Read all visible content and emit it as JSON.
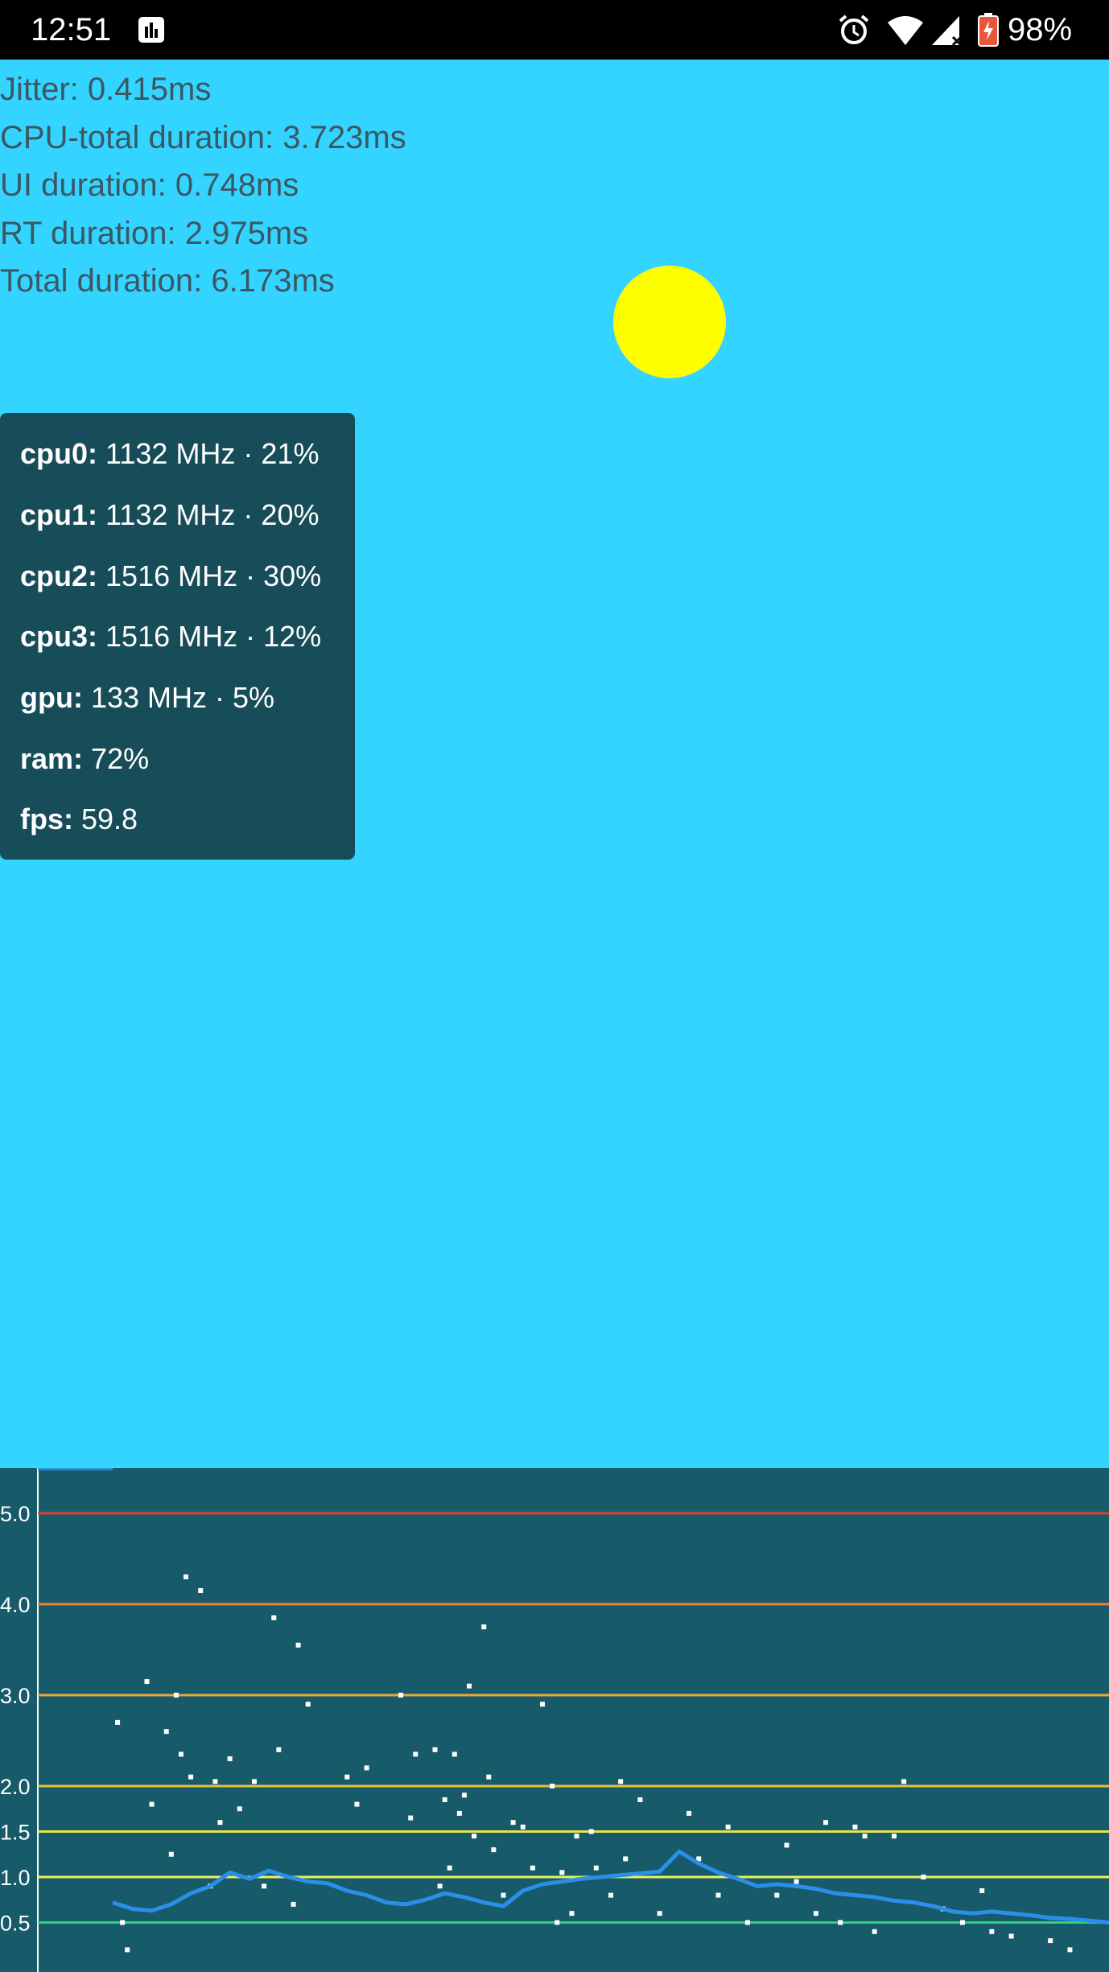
{
  "status_bar": {
    "time": "12:51",
    "battery_percent": "98%",
    "icons": [
      "app-notification-icon",
      "alarm-icon",
      "wifi-icon",
      "cell-signal-icon",
      "battery-charging-icon"
    ],
    "battery_color": "#e8573a"
  },
  "stats": {
    "jitter": "Jitter: 0.415ms",
    "cpu_total": "CPU-total duration: 3.723ms",
    "ui_duration": "UI duration: 0.748ms",
    "rt_duration": "RT duration: 2.975ms",
    "total_duration": "Total duration: 6.173ms"
  },
  "colors": {
    "background": "#33d4ff",
    "ball": "#ffff00",
    "panel": "#174c59",
    "graph_bg": "#175a6a"
  },
  "hud": {
    "rows": [
      {
        "key": "cpu0:",
        "value": "1132 MHz · 21%"
      },
      {
        "key": "cpu1:",
        "value": "1132 MHz · 20%"
      },
      {
        "key": "cpu2:",
        "value": "1516 MHz · 30%"
      },
      {
        "key": "cpu3:",
        "value": "1516 MHz · 12%"
      },
      {
        "key": "gpu:",
        "value": "133 MHz · 5%"
      },
      {
        "key": "ram:",
        "value": "72%"
      },
      {
        "key": "fps:",
        "value": "59.8"
      }
    ]
  },
  "chart_data": {
    "type": "scatter",
    "title": "",
    "xlabel": "",
    "ylabel": "",
    "ylim": [
      0,
      5.5
    ],
    "y_ticks": [
      "5.0",
      "4.0",
      "3.0",
      "2.0",
      "1.5",
      "1.0",
      "0.5"
    ],
    "threshold_lines": [
      {
        "value": 5.0,
        "color": "#d9432f"
      },
      {
        "value": 4.0,
        "color": "#e8872e"
      },
      {
        "value": 3.0,
        "color": "#eaa637"
      },
      {
        "value": 2.0,
        "color": "#e3c23f"
      },
      {
        "value": 1.5,
        "color": "#e5e34a"
      },
      {
        "value": 1.0,
        "color": "#e8f35c"
      },
      {
        "value": 0.5,
        "color": "#2fd37c"
      }
    ],
    "series": [
      {
        "type": "line",
        "color": "#2b8fe8",
        "x": [
          0,
          20,
          40,
          60,
          80,
          100,
          120,
          140,
          160,
          180,
          200,
          220,
          240,
          260,
          280,
          300,
          320,
          340,
          360,
          380,
          400,
          420,
          440,
          460,
          480,
          500,
          520,
          540,
          560,
          580,
          600,
          620,
          640,
          660,
          680,
          700,
          720,
          740,
          760,
          780,
          800,
          820,
          840,
          860,
          880,
          900,
          920,
          940,
          960,
          980,
          1000,
          1020
        ],
        "y": [
          0.72,
          0.65,
          0.63,
          0.7,
          0.82,
          0.9,
          1.05,
          0.98,
          1.07,
          1.0,
          0.95,
          0.93,
          0.85,
          0.8,
          0.72,
          0.7,
          0.75,
          0.82,
          0.78,
          0.72,
          0.68,
          0.85,
          0.92,
          0.95,
          0.98,
          1.0,
          1.02,
          1.04,
          1.06,
          1.28,
          1.15,
          1.05,
          0.98,
          0.9,
          0.92,
          0.9,
          0.87,
          0.82,
          0.8,
          0.78,
          0.74,
          0.72,
          0.68,
          0.62,
          0.6,
          0.62,
          0.6,
          0.58,
          0.55,
          0.54,
          0.52,
          0.5
        ]
      },
      {
        "type": "scatter",
        "color": "#ffffff",
        "x": [
          5,
          10,
          15,
          35,
          40,
          55,
          60,
          65,
          70,
          75,
          80,
          90,
          100,
          105,
          110,
          120,
          130,
          145,
          155,
          165,
          170,
          185,
          190,
          200,
          240,
          250,
          260,
          295,
          305,
          310,
          330,
          335,
          340,
          345,
          350,
          355,
          360,
          365,
          370,
          380,
          385,
          390,
          400,
          410,
          420,
          430,
          440,
          450,
          455,
          460,
          470,
          475,
          490,
          495,
          510,
          520,
          525,
          540,
          560,
          590,
          600,
          620,
          630,
          650,
          680,
          690,
          700,
          720,
          730,
          745,
          760,
          770,
          780,
          800,
          810,
          830,
          850,
          870,
          890,
          900,
          920,
          960,
          980
        ],
        "y": [
          2.7,
          0.5,
          0.2,
          3.15,
          1.8,
          2.6,
          1.25,
          3.0,
          2.35,
          4.3,
          2.1,
          4.15,
          0.9,
          2.05,
          1.6,
          2.3,
          1.75,
          2.05,
          0.9,
          3.85,
          2.4,
          0.7,
          3.55,
          2.9,
          2.1,
          1.8,
          2.2,
          3.0,
          1.65,
          2.35,
          2.4,
          0.9,
          1.85,
          1.1,
          2.35,
          1.7,
          1.9,
          3.1,
          1.45,
          3.75,
          2.1,
          1.3,
          0.8,
          1.6,
          1.55,
          1.1,
          2.9,
          2.0,
          0.5,
          1.05,
          0.6,
          1.45,
          1.5,
          1.1,
          0.8,
          2.05,
          1.2,
          1.85,
          0.6,
          1.7,
          1.2,
          0.8,
          1.55,
          0.5,
          0.8,
          1.35,
          0.95,
          0.6,
          1.6,
          0.5,
          1.55,
          1.45,
          0.4,
          1.45,
          2.05,
          1.0,
          0.65,
          0.5,
          0.85,
          0.4,
          0.35,
          0.3,
          0.2
        ]
      }
    ]
  }
}
